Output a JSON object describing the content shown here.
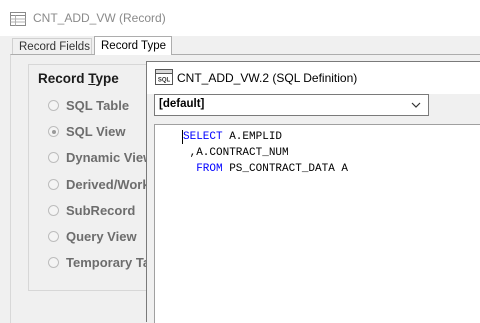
{
  "record_window": {
    "title": "CNT_ADD_VW (Record)",
    "icon": "record-icon",
    "tabs": [
      {
        "label": "Record Fields",
        "active": false
      },
      {
        "label": "Record Type",
        "active": true
      }
    ],
    "record_type": {
      "legend": "Record Type",
      "options": [
        {
          "label": "SQL Table",
          "selected": false
        },
        {
          "label": "SQL View",
          "selected": true
        },
        {
          "label": "Dynamic View",
          "selected": false
        },
        {
          "label": "Derived/Work",
          "selected": false
        },
        {
          "label": "SubRecord",
          "selected": false
        },
        {
          "label": "Query View",
          "selected": false
        },
        {
          "label": "Temporary Table",
          "selected": false
        }
      ]
    }
  },
  "sql_window": {
    "title": "CNT_ADD_VW.2 (SQL Definition)",
    "icon": "sql-icon",
    "icon_text": "SQL",
    "dropdown": {
      "value": "[default]",
      "icon": "chevron-down-icon"
    },
    "code": {
      "lines": [
        {
          "keyword": "SELECT",
          "rest": " A.EMPLID"
        },
        {
          "keyword": "",
          "rest": " ,A.CONTRACT_NUM"
        },
        {
          "keyword": "  FROM",
          "rest": " PS_CONTRACT_DATA A"
        }
      ],
      "keyword_color": "#0000ff"
    }
  }
}
